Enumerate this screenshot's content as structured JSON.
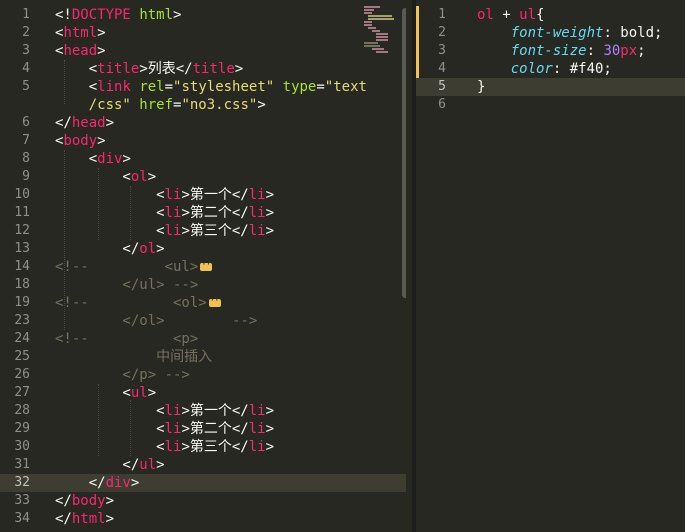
{
  "left": {
    "lines": [
      {
        "n": "1",
        "tokens": [
          [
            "punc",
            "<!"
          ],
          [
            "tag",
            "DOCTYPE"
          ],
          [
            "punc",
            " "
          ],
          [
            "attr",
            "html"
          ],
          [
            "punc",
            ">"
          ]
        ]
      },
      {
        "n": "2",
        "tokens": [
          [
            "punc",
            "<"
          ],
          [
            "tag",
            "html"
          ],
          [
            "punc",
            ">"
          ]
        ]
      },
      {
        "n": "3",
        "tokens": [
          [
            "punc",
            "<"
          ],
          [
            "tag",
            "head"
          ],
          [
            "punc",
            ">"
          ]
        ]
      },
      {
        "n": "4",
        "tokens": [
          [
            "punc",
            "    <"
          ],
          [
            "tag",
            "title"
          ],
          [
            "punc",
            ">列表</"
          ],
          [
            "tag",
            "title"
          ],
          [
            "punc",
            ">"
          ]
        ]
      },
      {
        "n": "5",
        "tokens": [
          [
            "punc",
            "    <"
          ],
          [
            "tag",
            "link"
          ],
          [
            "punc",
            " "
          ],
          [
            "attr",
            "rel"
          ],
          [
            "punc",
            "="
          ],
          [
            "str",
            "\"stylesheet\""
          ],
          [
            "punc",
            " "
          ],
          [
            "attr",
            "type"
          ],
          [
            "punc",
            "="
          ],
          [
            "str",
            "\"text"
          ]
        ]
      },
      {
        "n": "",
        "tokens": [
          [
            "str",
            "    /css\""
          ],
          [
            "punc",
            " "
          ],
          [
            "attr",
            "href"
          ],
          [
            "punc",
            "="
          ],
          [
            "str",
            "\"no3.css\""
          ],
          [
            "punc",
            ">"
          ]
        ]
      },
      {
        "n": "6",
        "tokens": [
          [
            "punc",
            "</"
          ],
          [
            "tag",
            "head"
          ],
          [
            "punc",
            ">"
          ]
        ]
      },
      {
        "n": "7",
        "tokens": [
          [
            "punc",
            "<"
          ],
          [
            "tag",
            "body"
          ],
          [
            "punc",
            ">"
          ]
        ]
      },
      {
        "n": "8",
        "tokens": [
          [
            "punc",
            "    <"
          ],
          [
            "tag",
            "div"
          ],
          [
            "punc",
            ">"
          ]
        ]
      },
      {
        "n": "9",
        "tokens": [
          [
            "punc",
            "        <"
          ],
          [
            "tag",
            "ol"
          ],
          [
            "punc",
            ">"
          ]
        ]
      },
      {
        "n": "10",
        "tokens": [
          [
            "punc",
            "            <"
          ],
          [
            "tag",
            "li"
          ],
          [
            "punc",
            ">第一个</"
          ],
          [
            "tag",
            "li"
          ],
          [
            "punc",
            ">"
          ]
        ]
      },
      {
        "n": "11",
        "tokens": [
          [
            "punc",
            "            <"
          ],
          [
            "tag",
            "li"
          ],
          [
            "punc",
            ">第二个</"
          ],
          [
            "tag",
            "li"
          ],
          [
            "punc",
            ">"
          ]
        ]
      },
      {
        "n": "12",
        "tokens": [
          [
            "punc",
            "            <"
          ],
          [
            "tag",
            "li"
          ],
          [
            "punc",
            ">第三个</"
          ],
          [
            "tag",
            "li"
          ],
          [
            "punc",
            ">"
          ]
        ]
      },
      {
        "n": "13",
        "tokens": [
          [
            "punc",
            "        </"
          ],
          [
            "tag",
            "ol"
          ],
          [
            "punc",
            ">"
          ]
        ]
      },
      {
        "n": "14",
        "tokens": [
          [
            "cmt",
            "<!--         <ul>"
          ]
        ],
        "fold": true
      },
      {
        "n": "18",
        "tokens": [
          [
            "cmt",
            "        </ul> -->"
          ]
        ]
      },
      {
        "n": "19",
        "tokens": [
          [
            "cmt",
            "<!--          <ol>"
          ]
        ],
        "fold": true
      },
      {
        "n": "23",
        "tokens": [
          [
            "cmt",
            "        </ol>        -->"
          ]
        ]
      },
      {
        "n": "24",
        "tokens": [
          [
            "cmt",
            "<!--          <p>"
          ]
        ]
      },
      {
        "n": "25",
        "tokens": [
          [
            "cmt",
            "            中间插入"
          ]
        ]
      },
      {
        "n": "26",
        "tokens": [
          [
            "cmt",
            "        </p> -->"
          ]
        ]
      },
      {
        "n": "27",
        "tokens": [
          [
            "punc",
            "        <"
          ],
          [
            "tag",
            "ul"
          ],
          [
            "punc",
            ">"
          ]
        ]
      },
      {
        "n": "28",
        "tokens": [
          [
            "punc",
            "            <"
          ],
          [
            "tag",
            "li"
          ],
          [
            "punc",
            ">第一个</"
          ],
          [
            "tag",
            "li"
          ],
          [
            "punc",
            ">"
          ]
        ]
      },
      {
        "n": "29",
        "tokens": [
          [
            "punc",
            "            <"
          ],
          [
            "tag",
            "li"
          ],
          [
            "punc",
            ">第二个</"
          ],
          [
            "tag",
            "li"
          ],
          [
            "punc",
            ">"
          ]
        ]
      },
      {
        "n": "30",
        "tokens": [
          [
            "punc",
            "            <"
          ],
          [
            "tag",
            "li"
          ],
          [
            "punc",
            ">第三个</"
          ],
          [
            "tag",
            "li"
          ],
          [
            "punc",
            ">"
          ]
        ]
      },
      {
        "n": "31",
        "tokens": [
          [
            "punc",
            "        </"
          ],
          [
            "tag",
            "ul"
          ],
          [
            "punc",
            ">"
          ]
        ]
      },
      {
        "n": "32",
        "tokens": [
          [
            "punc",
            "    </"
          ],
          [
            "tag",
            "div"
          ],
          [
            "punc",
            ">"
          ]
        ],
        "active": true
      },
      {
        "n": "33",
        "tokens": [
          [
            "punc",
            "</"
          ],
          [
            "tag",
            "body"
          ],
          [
            "punc",
            ">"
          ]
        ]
      },
      {
        "n": "34",
        "tokens": [
          [
            "punc",
            "</"
          ],
          [
            "tag",
            "html"
          ],
          [
            "punc",
            ">"
          ]
        ]
      }
    ]
  },
  "right": {
    "lines": [
      {
        "n": "1",
        "tokens": [
          [
            "tag",
            "ol"
          ],
          [
            "punc",
            " + "
          ],
          [
            "tag",
            "ul"
          ],
          [
            "punc",
            "{"
          ]
        ]
      },
      {
        "n": "2",
        "tokens": [
          [
            "prop",
            "    font-weight"
          ],
          [
            "punc",
            ": bold;"
          ]
        ]
      },
      {
        "n": "3",
        "tokens": [
          [
            "prop",
            "    font-size"
          ],
          [
            "punc",
            ": "
          ],
          [
            "num",
            "30"
          ],
          [
            "unit",
            "px"
          ],
          [
            "punc",
            ";"
          ]
        ]
      },
      {
        "n": "4",
        "tokens": [
          [
            "prop",
            "    color"
          ],
          [
            "punc",
            ": #f40;"
          ]
        ]
      },
      {
        "n": "5",
        "tokens": [
          [
            "punc",
            "}"
          ]
        ],
        "active": true
      },
      {
        "n": "6",
        "tokens": []
      }
    ]
  },
  "theme": {
    "background": "#272822",
    "tag": "#f92672",
    "attr": "#a6e22e",
    "string": "#e6db74",
    "comment": "#75715e",
    "property": "#66d9ef",
    "number": "#ae81ff",
    "fold_marker": "#f2c14e"
  }
}
